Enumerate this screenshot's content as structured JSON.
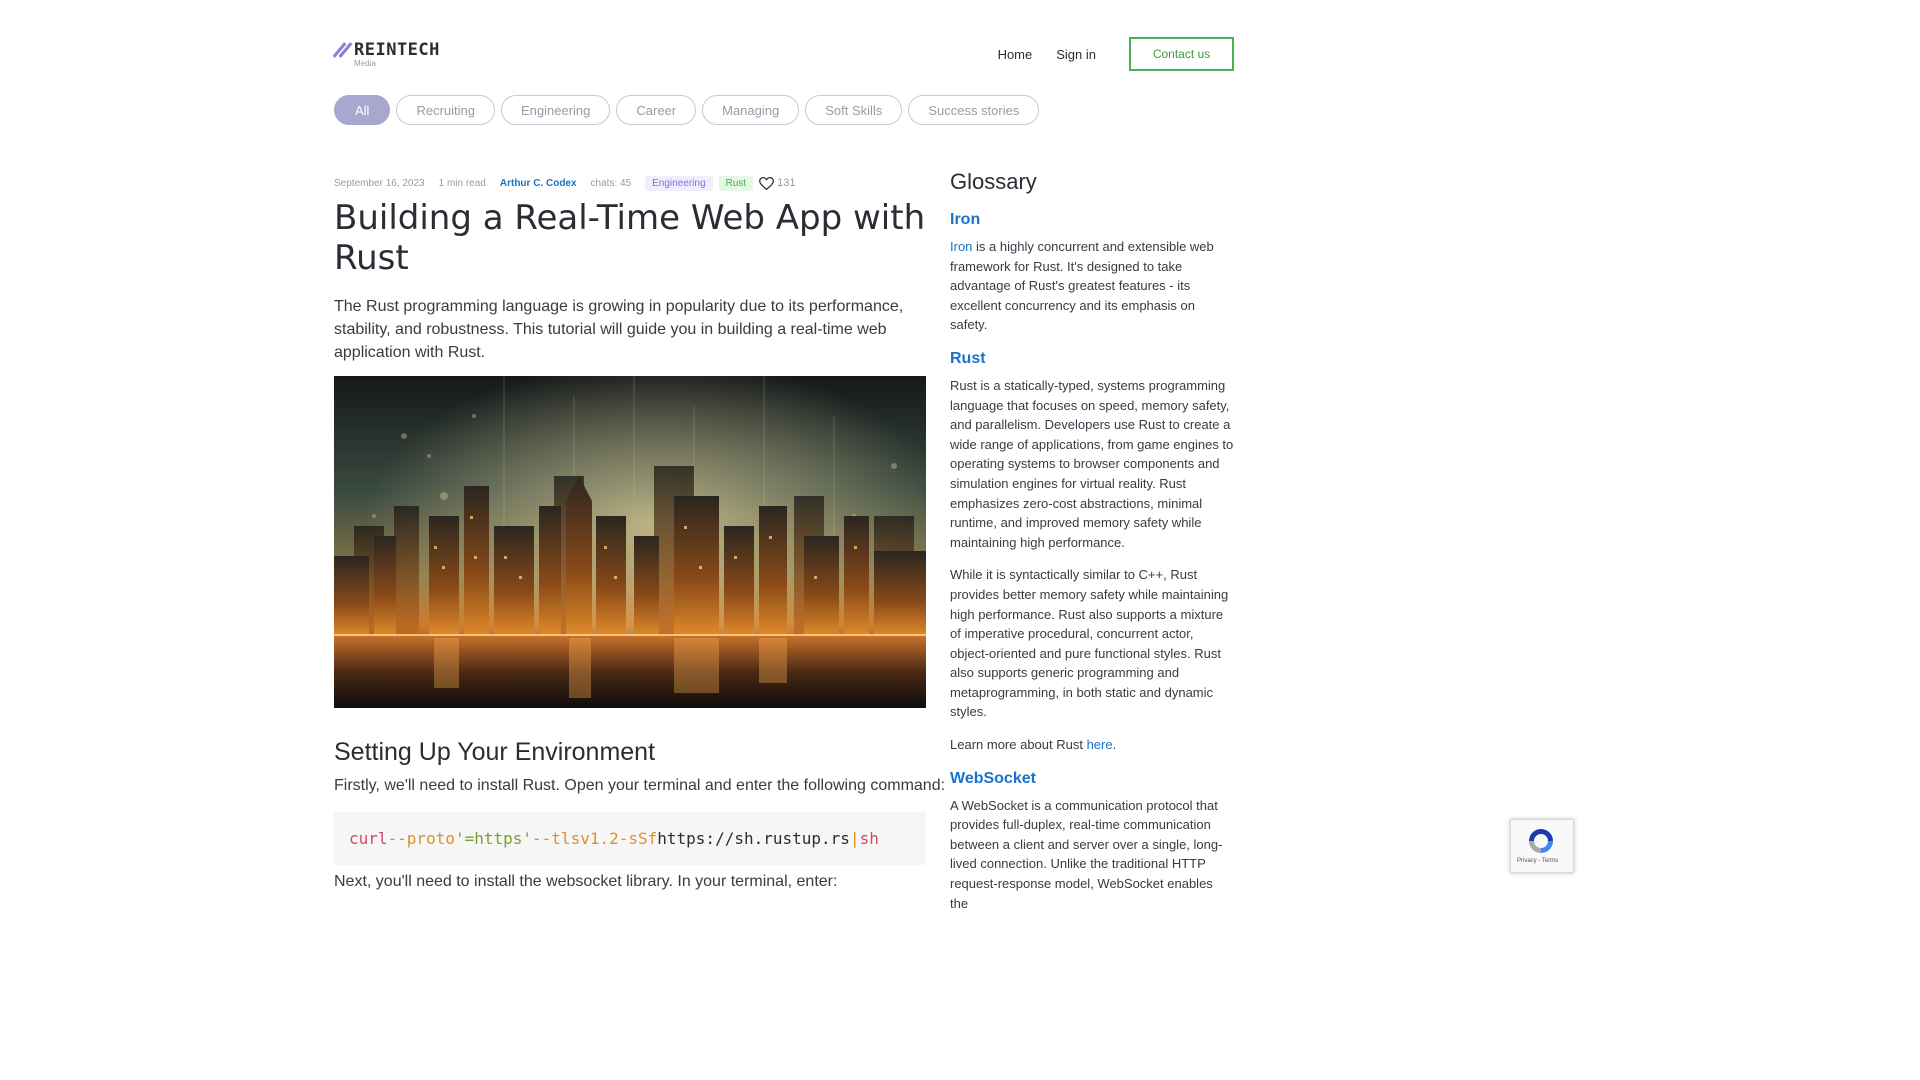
{
  "header": {
    "logo_text": "REINTECH",
    "logo_sub": "Media",
    "nav": {
      "home": "Home",
      "sign_in": "Sign in",
      "contact": "Contact us"
    }
  },
  "tabs": [
    "All",
    "Recruiting",
    "Engineering",
    "Career",
    "Managing",
    "Soft Skills",
    "Success stories"
  ],
  "article": {
    "date": "September 16, 2023",
    "read_time": "1 min read",
    "author": "Arthur C. Codex",
    "chats": "chats: 45",
    "tags": [
      "Engineering",
      "Rust"
    ],
    "likes": "131",
    "title": "Building a Real-Time Web App with Rust",
    "lead": "The Rust programming language is growing in popularity due to its performance, stability, and robustness. This tutorial will guide you in building a real-time web application with Rust.",
    "section_title": "Setting Up Your Environment",
    "section_text": "Firstly, we'll need to install Rust. Open your terminal and enter the following command:",
    "code": {
      "cmd": "curl",
      "flag1": "--proto",
      "arg1": "'=https'",
      "flag2": "--tlsv1.2",
      "flag3": "-sSf",
      "url": "https://sh.rustup.rs",
      "pipe": "|",
      "sh": "sh"
    },
    "next_text": "Next, you'll need to install the websocket library. In your terminal, enter:"
  },
  "glossary": {
    "title": "Glossary",
    "iron": {
      "term": "Iron",
      "link": "Iron",
      "text": " is a highly concurrent and extensible web framework for Rust. It's designed to take advantage of Rust's greatest features - its excellent concurrency and its emphasis on safety."
    },
    "rust": {
      "term": "Rust",
      "p1": "Rust is a statically-typed, systems programming language that focuses on speed, memory safety, and parallelism. Developers use Rust to create a wide range of applications, from game engines to operating systems to browser components and simulation engines for virtual reality. Rust emphasizes zero-cost abstractions, minimal runtime, and improved memory safety while maintaining high performance.",
      "p2": "While it is syntactically similar to C++, Rust provides better memory safety while maintaining high performance. Rust also supports a mixture of imperative procedural, concurrent actor, object-oriented and pure functional styles. Rust also supports generic programming and metaprogramming, in both static and dynamic styles.",
      "learn_more": "Learn more about Rust ",
      "learn_link": "here",
      "learn_end": "."
    },
    "websocket": {
      "term": "WebSocket",
      "text": "A WebSocket is a communication protocol that provides full-duplex, real-time communication between a client and server over a single, long-lived connection. Unlike the traditional HTTP request-response model, WebSocket enables the"
    }
  },
  "recaptcha": {
    "links": "Privacy - Terms"
  }
}
